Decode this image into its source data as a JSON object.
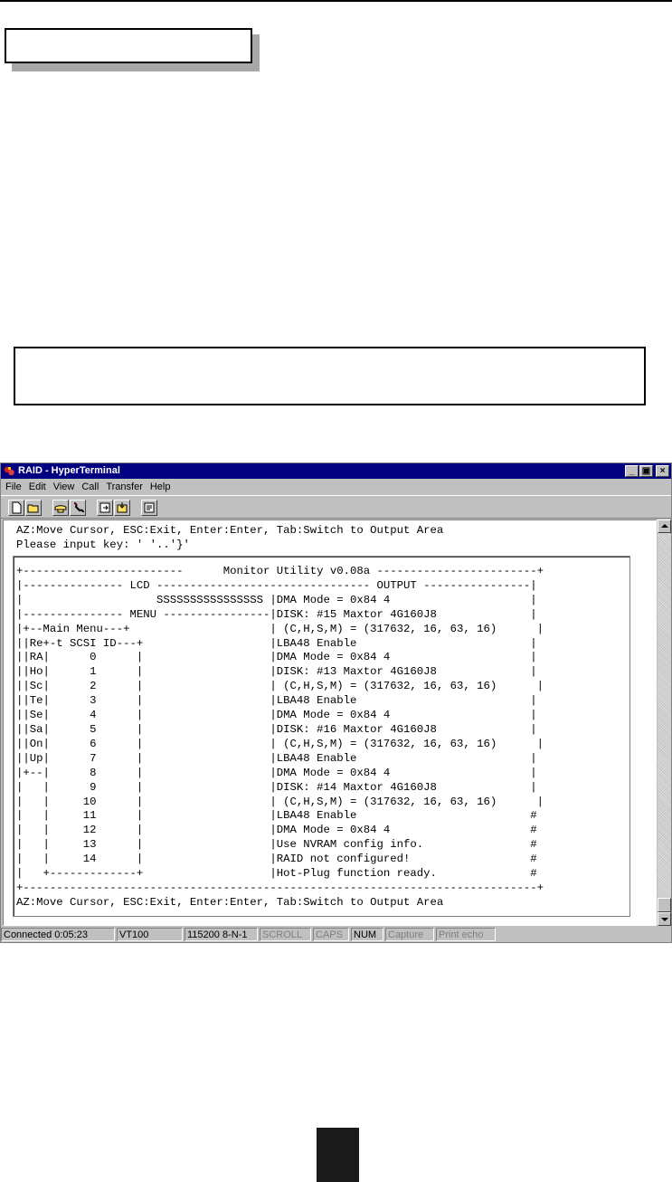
{
  "window": {
    "title": "RAID - HyperTerminal",
    "buttons": {
      "minimize": "_",
      "maximize": "▣",
      "close": "×"
    }
  },
  "menu": {
    "file": "File",
    "edit": "Edit",
    "view": "View",
    "call": "Call",
    "transfer": "Transfer",
    "help": "Help"
  },
  "toolbar": {
    "icons": [
      "new-document-icon",
      "open-folder-icon",
      "connect-phone-icon",
      "disconnect-phone-icon",
      "send-icon",
      "receive-icon",
      "properties-icon"
    ]
  },
  "terminal": {
    "header_lines": "AZ:Move Cursor, ESC:Exit, Enter:Enter, Tab:Switch to Output Area\nPlease input key: ' '..'}'",
    "screen": "+------------------------      Monitor Utility v0.08a ------------------------+\n|--------------- LCD -------------------------------- OUTPUT ----------------|\n|                    SSSSSSSSSSSSSSSS |DMA Mode = 0x84 4                     |\n|--------------- MENU ----------------|DISK: #15 Maxtor 4G160J8              |\n|+--Main Menu---+                     | (C,H,S,M) = (317632, 16, 63, 16)      |\n||Re+-t SCSI ID---+                   |LBA48 Enable                          |\n||RA|      0      |                   |DMA Mode = 0x84 4                     |\n||Ho|      1      |                   |DISK: #13 Maxtor 4G160J8              |\n||Sc|      2      |                   | (C,H,S,M) = (317632, 16, 63, 16)      |\n||Te|      3      |                   |LBA48 Enable                          |\n||Se|      4      |                   |DMA Mode = 0x84 4                     |\n||Sa|      5      |                   |DISK: #16 Maxtor 4G160J8              |\n||On|      6      |                   | (C,H,S,M) = (317632, 16, 63, 16)      |\n||Up|      7      |                   |LBA48 Enable                          |\n|+--|      8      |                   |DMA Mode = 0x84 4                     |\n|   |      9      |                   |DISK: #14 Maxtor 4G160J8              |\n|   |     10      |                   | (C,H,S,M) = (317632, 16, 63, 16)      |\n|   |     11      |                   |LBA48 Enable                          #\n|   |     12      |                   |DMA Mode = 0x84 4                     #\n|   |     13      |                   |Use NVRAM config info.                #\n|   |     14      |                   |RAID not configured!                  #\n|   +-------------+                   |Hot-Plug function ready.              #\n+-----------------------------------------------------------------------------+\nAZ:Move Cursor, ESC:Exit, Enter:Enter, Tab:Switch to Output Area"
  },
  "statusbar": {
    "connected": "Connected 0:05:23",
    "emulation": "VT100",
    "settings": "115200 8-N-1",
    "scroll": "SCROLL",
    "caps": "CAPS",
    "num": "NUM",
    "capture": "Capture",
    "printecho": "Print echo"
  }
}
